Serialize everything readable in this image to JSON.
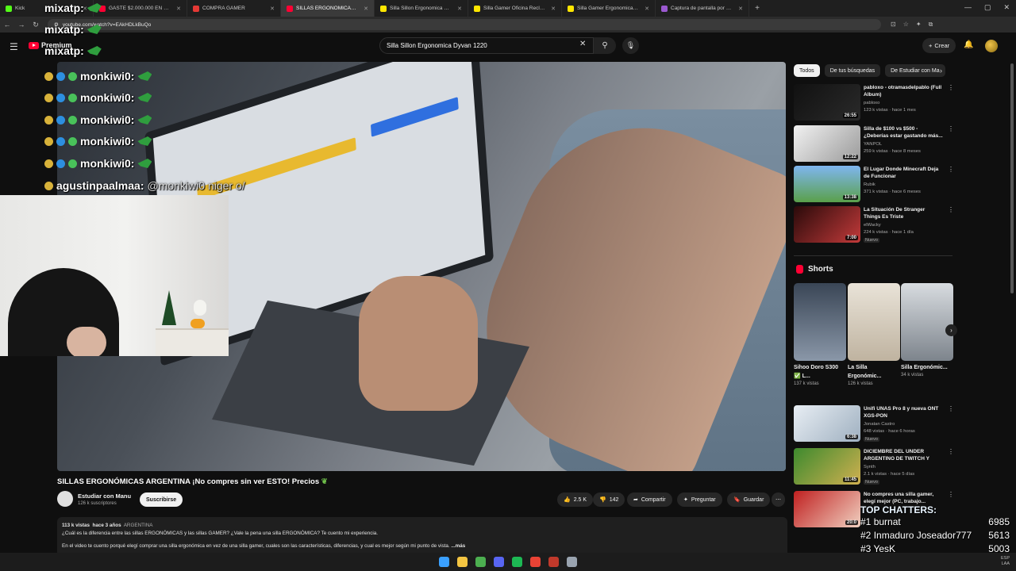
{
  "browser": {
    "tabs": [
      {
        "label": "Kick",
        "color": "#53fc18",
        "active": false
      },
      {
        "label": "GASTE $2.000.000 EN EL COTO",
        "color": "#ff0033",
        "active": false
      },
      {
        "label": "COMPRA GAMER",
        "color": "#e53935",
        "active": false
      },
      {
        "label": "SILLAS ERGONÓMICAS AR",
        "color": "#ff0033",
        "active": true
      },
      {
        "label": "Silla Sillon Ergonomica Dyvan",
        "color": "#ffe600",
        "active": false
      },
      {
        "label": "Silla Gamer Oficina Reclinable",
        "color": "#ffe600",
        "active": false
      },
      {
        "label": "Silla Gamer Ergonomica Ideon",
        "color": "#ffe600",
        "active": false
      },
      {
        "label": "Captura de pantalla por Lightshot",
        "color": "#9b59d0",
        "active": false
      }
    ],
    "url": "youtube.com/watch?v=EAkHDLkBuQo"
  },
  "header": {
    "brand": "Premium",
    "search_value": "Silla Sillon Ergonomica Dyvan 1220",
    "create_label": "Crear"
  },
  "overlay_chat": [
    {
      "user": "mixatp:",
      "msg": "",
      "badges": 0
    },
    {
      "user": "mixatp:",
      "msg": "",
      "badges": 0
    },
    {
      "user": "mixatp:",
      "msg": "",
      "badges": 0
    },
    {
      "user": "monkiwi0:",
      "msg": "",
      "badges": 3
    },
    {
      "user": "monkiwi0:",
      "msg": "",
      "badges": 3
    },
    {
      "user": "monkiwi0:",
      "msg": "",
      "badges": 3
    },
    {
      "user": "monkiwi0:",
      "msg": "",
      "badges": 3
    },
    {
      "user": "monkiwi0:",
      "msg": "",
      "badges": 3
    },
    {
      "user": "agustinpaalmaa:",
      "msg": "@monkiwi0 niger o/",
      "badges": 1
    }
  ],
  "video": {
    "title": "SILLAS ERGONÓMICAS ARGENTINA ¡No compres sin ver ESTO! Precios",
    "channel": "Estudiar con Manu",
    "subscribers": "126 k suscriptores",
    "subscribe_label": "Suscribirse",
    "likes": "2.5 K",
    "dislikes": "142",
    "share_label": "Compartir",
    "ask_label": "Preguntar",
    "save_label": "Guardar",
    "views": "113 k vistas",
    "age": "hace 3 años",
    "tag": "ARGENTINA",
    "desc_line1": "¿Cuál es la diferencia entre las sillas ERGONÓMICAS y las sillas GAMER? ¿Vale la pena una silla ERGONÓMICA? Te cuento mi experiencia.",
    "desc_line2": "En el video te cuento porqué elegí comprar una silla ergonómica en vez de una silla gamer, cuales son las características, diferencias, y cual es mejor según mi punto de vista.",
    "more": "...más"
  },
  "chips": [
    "Todos",
    "De tus búsquedas",
    "De Estudiar con Ma"
  ],
  "recommendations": [
    {
      "title": "pabloxo - otramasdelpablo (Full Album)",
      "channel": "pabloxo",
      "meta": "123 k vistas · hace 1 mes",
      "duration": "26:55",
      "new": "",
      "thumb": "linear-gradient(135deg,#111,#2a2a2a)"
    },
    {
      "title": "Silla de $100 vs $500 - ¿Deberías estar gastando más...",
      "channel": "YANPOL",
      "meta": "259 k vistas · hace 8 meses",
      "duration": "12:22",
      "new": "",
      "thumb": "linear-gradient(135deg,#f2f2f2,#9a9a9a)"
    },
    {
      "title": "El Lugar Donde Minecraft Deja de Funcionar",
      "channel": "Rubik",
      "meta": "371 k vistas · hace 6 meses",
      "duration": "13:38",
      "new": "",
      "thumb": "linear-gradient(180deg,#7fb6f0,#5aa04a)"
    },
    {
      "title": "La Situación De Stranger Things Es Triste",
      "channel": "elWacky",
      "meta": "224 k vistas · hace 1 día",
      "duration": "7:00",
      "new": "Nuevo",
      "thumb": "linear-gradient(135deg,#2a0a0a,#c23a3a)"
    },
    {
      "title": "Unifi UNAS Pro 8 y nueva ONT XGS-PON",
      "channel": "Jonatan Castro",
      "meta": "648 vistas · hace 6 horas",
      "duration": "6:38",
      "new": "Nuevo",
      "thumb": "linear-gradient(135deg,#e8eef4,#9fb0c0)"
    },
    {
      "title": "DICIEMBRE DEL UNDER ARGENTINO DE TWITCH Y KIC...",
      "channel": "Synth",
      "meta": "2.1 k vistas · hace 5 días",
      "duration": "11:45",
      "new": "Nuevo",
      "thumb": "linear-gradient(135deg,#3d8a2e,#d0b050)"
    },
    {
      "title": "No compres una silla gamer, elegí mejor (PC, trabajo...",
      "channel": "",
      "meta": "",
      "duration": "20:0",
      "new": "",
      "thumb": "linear-gradient(135deg,#c02020,#f0d0c0)"
    }
  ],
  "shorts": {
    "heading": "Shorts",
    "items": [
      {
        "title": "Sihoo Doro S300 ✅ L...",
        "views": "137 k vistas",
        "thumb": "linear-gradient(180deg,#3a4656,#8a97a8)"
      },
      {
        "title": "La Silla Ergonómic...",
        "views": "126 k vistas",
        "thumb": "linear-gradient(180deg,#e9e3d8,#bfb3a0)"
      },
      {
        "title": "Silla Ergonómic...",
        "views": "34 k vistas",
        "thumb": "linear-gradient(180deg,#d8dce0,#7d848c)"
      }
    ]
  },
  "top_chatters": {
    "title": "TOP CHATTERS:",
    "rows": [
      {
        "rank": "#1",
        "name": "burnat",
        "count": "6985"
      },
      {
        "rank": "#2",
        "name": "Inmaduro Joseador777",
        "count": "5613"
      },
      {
        "rank": "#3",
        "name": "YesK",
        "count": "5003"
      }
    ]
  },
  "taskbar": {
    "icons": [
      "windows-icon",
      "file-explorer-icon",
      "chrome-icon",
      "discord-icon",
      "spotify-icon",
      "chrome-alt-icon",
      "obs-icon",
      "steam-icon"
    ],
    "tray_lang": "ESP\nLAA"
  },
  "colors": {
    "accent": "#ff0033",
    "bg": "#0f0f0f",
    "kick": "#53fc18"
  }
}
